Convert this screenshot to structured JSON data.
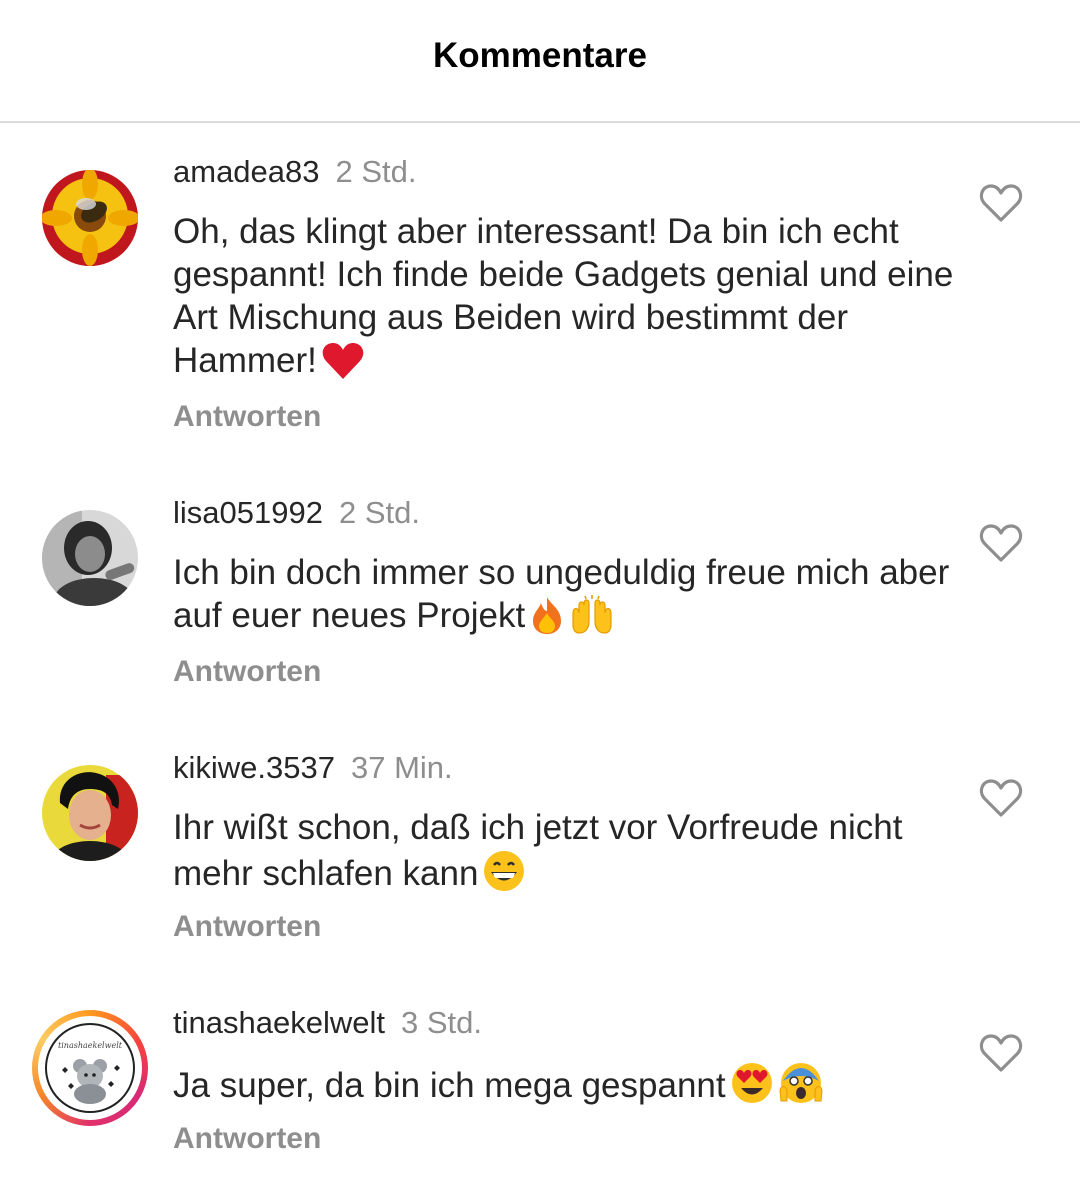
{
  "header": {
    "title": "Kommentare"
  },
  "comments": [
    {
      "username": "amadea83",
      "time": "2 Std.",
      "text": "Oh, das klingt aber interessant! Da bin ich echt gespannt! Ich finde beide Gadgets genial und eine Art Mischung aus Beiden wird bestimmt der Hammer!",
      "emojis": [
        "red-heart"
      ],
      "reply_label": "Antworten",
      "like_icon": "heart-outline-icon"
    },
    {
      "username": "lisa051992",
      "time": "2 Std.",
      "text": "Ich bin doch immer so ungeduldig freue mich aber auf euer neues Projekt",
      "emojis": [
        "fire",
        "raising-hands"
      ],
      "reply_label": "Antworten",
      "like_icon": "heart-outline-icon"
    },
    {
      "username": "kikiwe.3537",
      "time": "37 Min.",
      "text": "Ihr wißt schon, daß ich jetzt vor Vorfreude nicht mehr schlafen kann",
      "emojis": [
        "grinning-face"
      ],
      "reply_label": "Antworten",
      "like_icon": "heart-outline-icon"
    },
    {
      "username": "tinashaekelwelt",
      "time": "3 Std.",
      "text": "Ja super, da bin ich mega gespannt",
      "emojis": [
        "heart-eyes",
        "screaming-face"
      ],
      "reply_label": "Antworten",
      "like_icon": "heart-outline-icon",
      "avatar_label": "tinashaekelwelt"
    }
  ]
}
